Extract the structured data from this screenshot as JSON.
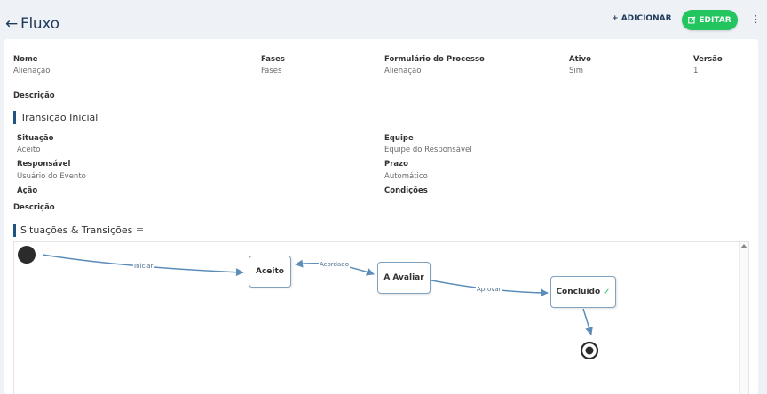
{
  "header": {
    "title": "Fluxo",
    "add_label": "ADICIONAR",
    "edit_label": "EDITAR"
  },
  "info": {
    "nome_label": "Nome",
    "nome_value": "Alienação",
    "fases_label": "Fases",
    "fases_value": "Fases",
    "formulario_label": "Formulário do Processo",
    "formulario_value": "Alienação",
    "ativo_label": "Ativo",
    "ativo_value": "Sim",
    "versao_label": "Versão",
    "versao_value": "1",
    "descricao_label": "Descrição"
  },
  "transicao_inicial": {
    "title": "Transição Inicial",
    "situacao_label": "Situação",
    "situacao_value": "Aceito",
    "equipe_label": "Equipe",
    "equipe_value": "Equipe do Responsável",
    "responsavel_label": "Responsável",
    "responsavel_value": "Usuário do Evento",
    "prazo_label": "Prazo",
    "prazo_value": "Automático",
    "acao_label": "Ação",
    "condicoes_label": "Condições",
    "descricao_label": "Descrição"
  },
  "diagram": {
    "title": "Situações & Transições",
    "nodes": {
      "aceito": "Aceito",
      "a_avaliar": "A Avaliar",
      "concluido": "Concluído"
    },
    "edges": {
      "iniciar": "Iniciar",
      "acordado": "Acordado",
      "aprovar": "Aprovar"
    }
  },
  "colors": {
    "accent": "#1f3b5a",
    "edit_button": "#22c55e",
    "edge": "#5b8db8",
    "check": "#22c55e"
  }
}
